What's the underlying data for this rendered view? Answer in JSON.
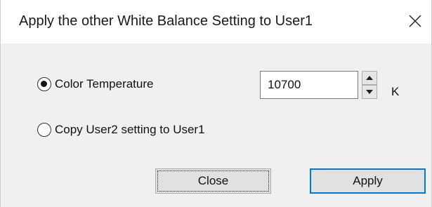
{
  "window": {
    "title": "Apply the other White Balance Setting to User1",
    "close_icon": "close-icon"
  },
  "options": {
    "color_temperature": {
      "label": "Color Temperature",
      "selected": true
    },
    "copy_user2": {
      "label": "Copy User2 setting to User1",
      "selected": false
    }
  },
  "temperature": {
    "value": "10700",
    "unit": "K",
    "up_icon": "spin-up-icon",
    "down_icon": "spin-down-icon"
  },
  "buttons": {
    "close_label": "Close",
    "apply_label": "Apply"
  },
  "colors": {
    "accent": "#0078d7",
    "dialog_bg": "#f0f0f0",
    "titlebar_bg": "#ffffff"
  }
}
